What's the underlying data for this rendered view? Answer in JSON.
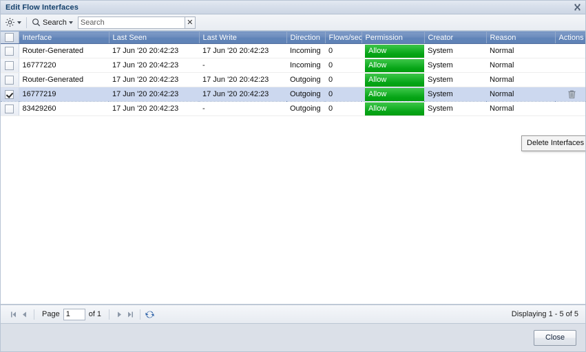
{
  "window": {
    "title": "Edit Flow Interfaces",
    "close_icon": "close-icon"
  },
  "toolbar": {
    "gear_icon": "gear-icon",
    "search_icon": "search-icon",
    "search_menu_label": "Search",
    "search_value": "",
    "search_placeholder": "Search",
    "clear_label": "✕"
  },
  "grid": {
    "columns": [
      {
        "key": "checkbox",
        "label": ""
      },
      {
        "key": "interface",
        "label": "Interface"
      },
      {
        "key": "last_seen",
        "label": "Last Seen"
      },
      {
        "key": "last_write",
        "label": "Last Write"
      },
      {
        "key": "direction",
        "label": "Direction"
      },
      {
        "key": "flows_sec",
        "label": "Flows/sec"
      },
      {
        "key": "permission",
        "label": "Permission"
      },
      {
        "key": "creator",
        "label": "Creator"
      },
      {
        "key": "reason",
        "label": "Reason"
      },
      {
        "key": "actions",
        "label": "Actions"
      }
    ],
    "header_select_all_checked": false,
    "rows": [
      {
        "selected": false,
        "interface": "Router-Generated",
        "last_seen": "17 Jun '20 20:42:23",
        "last_write": "17 Jun '20 20:42:23",
        "direction": "Incoming",
        "flows_sec": "0",
        "permission": "Allow",
        "creator": "System",
        "reason": "Normal",
        "action_icon": ""
      },
      {
        "selected": false,
        "interface": "16777220",
        "last_seen": "17 Jun '20 20:42:23",
        "last_write": "-",
        "direction": "Incoming",
        "flows_sec": "0",
        "permission": "Allow",
        "creator": "System",
        "reason": "Normal",
        "action_icon": ""
      },
      {
        "selected": false,
        "interface": "Router-Generated",
        "last_seen": "17 Jun '20 20:42:23",
        "last_write": "17 Jun '20 20:42:23",
        "direction": "Outgoing",
        "flows_sec": "0",
        "permission": "Allow",
        "creator": "System",
        "reason": "Normal",
        "action_icon": ""
      },
      {
        "selected": true,
        "interface": "16777219",
        "last_seen": "17 Jun '20 20:42:23",
        "last_write": "17 Jun '20 20:42:23",
        "direction": "Outgoing",
        "flows_sec": "0",
        "permission": "Allow",
        "creator": "System",
        "reason": "Normal",
        "action_icon": "trash-icon"
      },
      {
        "selected": false,
        "interface": "83429260",
        "last_seen": "17 Jun '20 20:42:23",
        "last_write": "-",
        "direction": "Outgoing",
        "flows_sec": "0",
        "permission": "Allow",
        "creator": "System",
        "reason": "Normal",
        "action_icon": ""
      }
    ]
  },
  "tooltip": {
    "text": "Delete Interfaces"
  },
  "pager": {
    "first_icon": "first-page-icon",
    "prev_icon": "previous-page-icon",
    "page_label": "Page",
    "page_value": "1",
    "of_label": "of 1",
    "next_icon": "next-page-icon",
    "last_icon": "last-page-icon",
    "refresh_icon": "refresh-icon",
    "display_text": "Displaying 1 - 5 of 5"
  },
  "footer": {
    "close_label": "Close"
  },
  "colors": {
    "header_blue": "#6084b8",
    "allow_green": "#06a416",
    "selected_row": "#ccd8ef",
    "title_text": "#14406b",
    "footer_bg": "#dbe0e8"
  }
}
